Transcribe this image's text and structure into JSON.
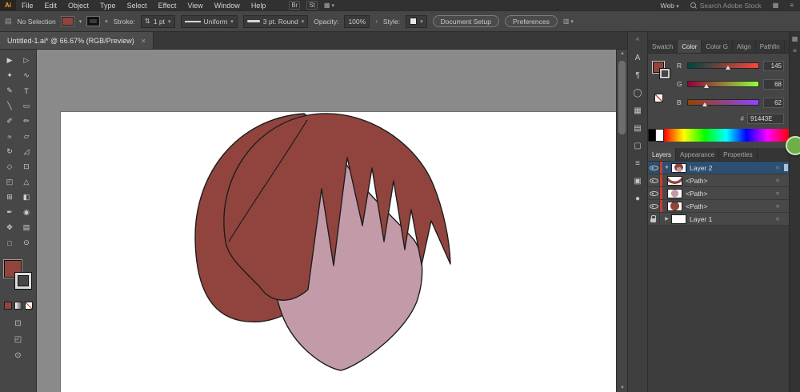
{
  "menubar": {
    "logo": "Ai",
    "items": [
      "File",
      "Edit",
      "Object",
      "Type",
      "Select",
      "Effect",
      "View",
      "Window",
      "Help"
    ],
    "br_button": "Br",
    "st_button": "St",
    "workspace": "Web",
    "search_placeholder": "Search Adobe Stock"
  },
  "controlbar": {
    "selection_label": "No Selection",
    "stroke_label": "Stroke:",
    "stroke_value": "1 pt",
    "variable_width_value": "Uniform",
    "brush_value": "3 pt. Round",
    "opacity_label": "Opacity:",
    "opacity_value": "100%",
    "style_label": "Style:",
    "document_setup_button": "Document Setup",
    "preferences_button": "Preferences"
  },
  "document_tab": {
    "title": "Untitled-1.ai* @ 66.67% (RGB/Preview)",
    "close": "×"
  },
  "tools": [
    {
      "name": "selection",
      "glyph": "▶"
    },
    {
      "name": "direct-selection",
      "glyph": "▷"
    },
    {
      "name": "magic-wand",
      "glyph": "✦"
    },
    {
      "name": "lasso",
      "glyph": "∿"
    },
    {
      "name": "pen",
      "glyph": "✎"
    },
    {
      "name": "type",
      "glyph": "T"
    },
    {
      "name": "line-segment",
      "glyph": "╲"
    },
    {
      "name": "rectangle",
      "glyph": "▭"
    },
    {
      "name": "paintbrush",
      "glyph": "✐"
    },
    {
      "name": "pencil",
      "glyph": "✏"
    },
    {
      "name": "shaper",
      "glyph": "≈"
    },
    {
      "name": "eraser",
      "glyph": "▱"
    },
    {
      "name": "rotate",
      "glyph": "↻"
    },
    {
      "name": "scale",
      "glyph": "◿"
    },
    {
      "name": "width",
      "glyph": "◇"
    },
    {
      "name": "free-transform",
      "glyph": "⊡"
    },
    {
      "name": "shape-builder",
      "glyph": "◰"
    },
    {
      "name": "perspective-grid",
      "glyph": "△"
    },
    {
      "name": "mesh",
      "glyph": "⊞"
    },
    {
      "name": "gradient",
      "glyph": "◧"
    },
    {
      "name": "eyedropper",
      "glyph": "✒"
    },
    {
      "name": "blend",
      "glyph": "◉"
    },
    {
      "name": "symbol-sprayer",
      "glyph": "✥"
    },
    {
      "name": "column-graph",
      "glyph": "▤"
    },
    {
      "name": "artboard",
      "glyph": "□"
    },
    {
      "name": "zoom",
      "glyph": "⊙"
    }
  ],
  "panel_strip": [
    {
      "name": "character",
      "glyph": "A"
    },
    {
      "name": "paragraph",
      "glyph": "¶"
    },
    {
      "name": "stroke",
      "glyph": "◯"
    },
    {
      "name": "swatches",
      "glyph": "▦"
    },
    {
      "name": "transform",
      "glyph": "▤"
    },
    {
      "name": "artboards",
      "glyph": "▢"
    },
    {
      "name": "appearance",
      "glyph": "≡"
    },
    {
      "name": "symbols",
      "glyph": "▣"
    },
    {
      "name": "libraries",
      "glyph": "●"
    }
  ],
  "color_panel": {
    "tabs": [
      "Swatch",
      "Color",
      "Color G",
      "Align",
      "Pathfin"
    ],
    "active_tab": "Color",
    "channels": [
      {
        "label": "R",
        "value": "145"
      },
      {
        "label": "G",
        "value": "68"
      },
      {
        "label": "B",
        "value": "62"
      }
    ],
    "hex_label": "#",
    "hex_value": "91443E"
  },
  "layers_panel": {
    "tabs": [
      "Layers",
      "Appearance",
      "Properties"
    ],
    "rows": [
      {
        "name": "Layer 2",
        "kind": "layer",
        "selected": true,
        "expanded": true
      },
      {
        "name": "<Path>",
        "kind": "path"
      },
      {
        "name": "<Path>",
        "kind": "path"
      },
      {
        "name": "<Path>",
        "kind": "path"
      },
      {
        "name": "Layer 1",
        "kind": "layer",
        "locked": true
      }
    ]
  },
  "artwork": {
    "hair_color": "#91443E",
    "face_color": "#C39BA8",
    "outline_color": "#1d1d1d"
  },
  "icons": {
    "dropdown": "▾",
    "chevron_right": "›",
    "target": "○",
    "collapse": "«",
    "grid": "▦",
    "list": "≡",
    "up": "▲",
    "down": "▼",
    "expand_down": "▼",
    "expand_right": "▶",
    "doc": "▤",
    "updown": "⇅",
    "align": "▥"
  },
  "colors": {
    "selection_blue": "#2d4f71",
    "layer_tag_red": "#cf3a30"
  }
}
